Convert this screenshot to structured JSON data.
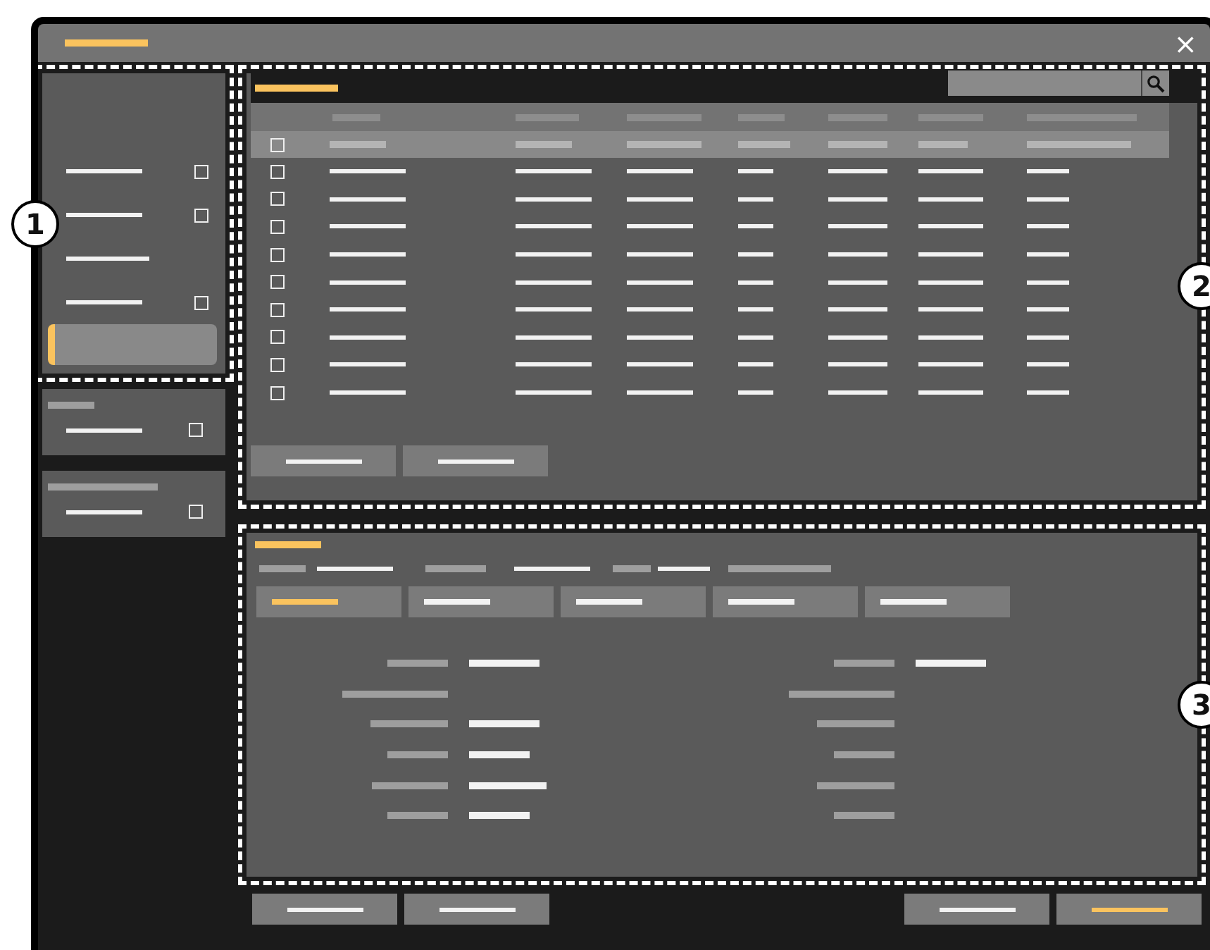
{
  "window": {
    "close": "×"
  },
  "callouts": [
    {
      "label": "1"
    },
    {
      "label": "2"
    },
    {
      "label": "3"
    }
  ],
  "sidebar": {
    "items": [
      {
        "kind": "checkbox",
        "checked": false,
        "selected": false
      },
      {
        "kind": "checkbox",
        "checked": false,
        "selected": false
      },
      {
        "kind": "plain",
        "selected": false
      },
      {
        "kind": "checkbox",
        "checked": false,
        "selected": false
      },
      {
        "kind": "empty",
        "selected": true
      }
    ],
    "cards": [
      {
        "items": [
          {
            "kind": "checkbox",
            "checked": false,
            "selected": false
          }
        ]
      },
      {
        "items": [
          {
            "kind": "checkbox",
            "checked": false,
            "selected": false
          }
        ]
      }
    ]
  },
  "table": {
    "rows": [
      {
        "selected": true,
        "checked": false
      },
      {
        "selected": false,
        "checked": false
      },
      {
        "selected": false,
        "checked": false
      },
      {
        "selected": false,
        "checked": false
      },
      {
        "selected": false,
        "checked": false
      },
      {
        "selected": false,
        "checked": false
      },
      {
        "selected": false,
        "checked": false
      },
      {
        "selected": false,
        "checked": false
      },
      {
        "selected": false,
        "checked": false
      },
      {
        "selected": false,
        "checked": false
      }
    ],
    "buttons": [
      {
        "kind": "secondary"
      },
      {
        "kind": "secondary"
      }
    ]
  },
  "details": {
    "tabs": [
      {
        "selected": true
      },
      {
        "selected": false
      },
      {
        "selected": false
      },
      {
        "selected": false
      },
      {
        "selected": false
      }
    ],
    "fields_left": [
      {
        "kind": "filled"
      },
      {
        "kind": "label"
      },
      {
        "kind": "filled"
      },
      {
        "kind": "filled"
      },
      {
        "kind": "filled"
      },
      {
        "kind": "filled"
      }
    ],
    "fields_right": [
      {
        "kind": "filled"
      },
      {
        "kind": "label"
      },
      {
        "kind": "label"
      },
      {
        "kind": "label"
      },
      {
        "kind": "label"
      },
      {
        "kind": "label"
      }
    ]
  },
  "footer_buttons": [
    {
      "kind": "secondary"
    },
    {
      "kind": "secondary"
    },
    {
      "kind": "secondary"
    },
    {
      "kind": "primary"
    }
  ]
}
